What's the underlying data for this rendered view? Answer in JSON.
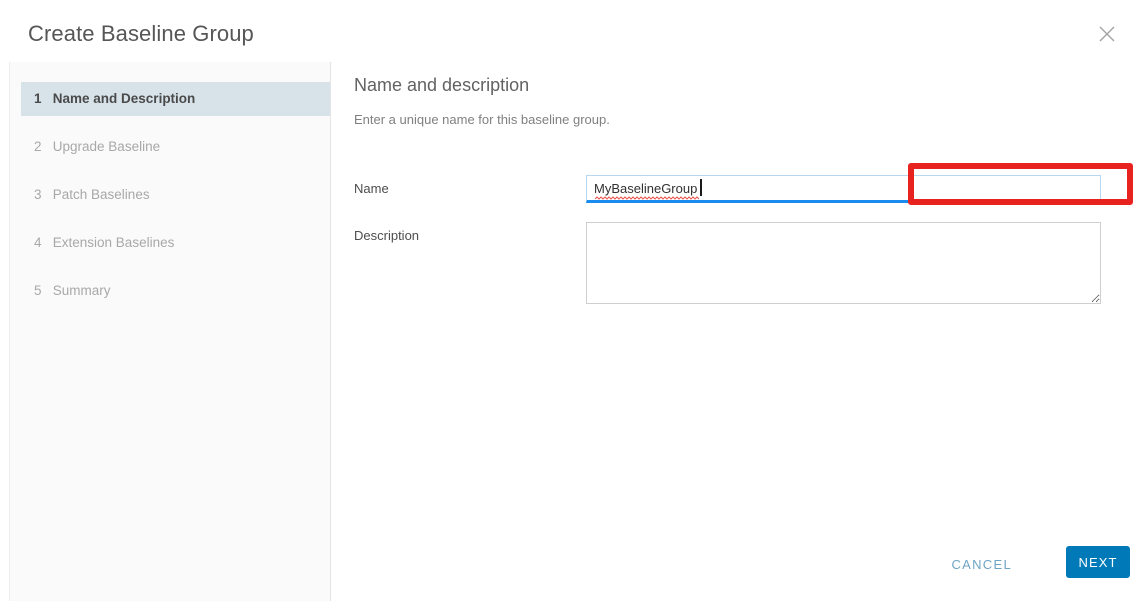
{
  "window": {
    "title": "Create Baseline Group",
    "close_icon": "close-icon"
  },
  "steps": [
    {
      "number": "1",
      "label": "Name and Description",
      "active": true
    },
    {
      "number": "2",
      "label": "Upgrade Baseline",
      "active": false
    },
    {
      "number": "3",
      "label": "Patch Baselines",
      "active": false
    },
    {
      "number": "4",
      "label": "Extension Baselines",
      "active": false
    },
    {
      "number": "5",
      "label": "Summary",
      "active": false
    }
  ],
  "content": {
    "heading": "Name and description",
    "subtitle": "Enter a unique name for this baseline group."
  },
  "form": {
    "name": {
      "label": "Name",
      "value": "MyBaselineGroup",
      "placeholder": ""
    },
    "description": {
      "label": "Description",
      "value": "",
      "placeholder": ""
    }
  },
  "footer": {
    "cancel_label": "Cancel",
    "next_label": "Next"
  },
  "colors": {
    "accent_blue": "#0079b8",
    "focus_underline": "#1a8cf0",
    "annotation_red": "#e8231f",
    "active_step_bg": "#d8e3e9",
    "sidebar_bg": "#fafafa"
  }
}
